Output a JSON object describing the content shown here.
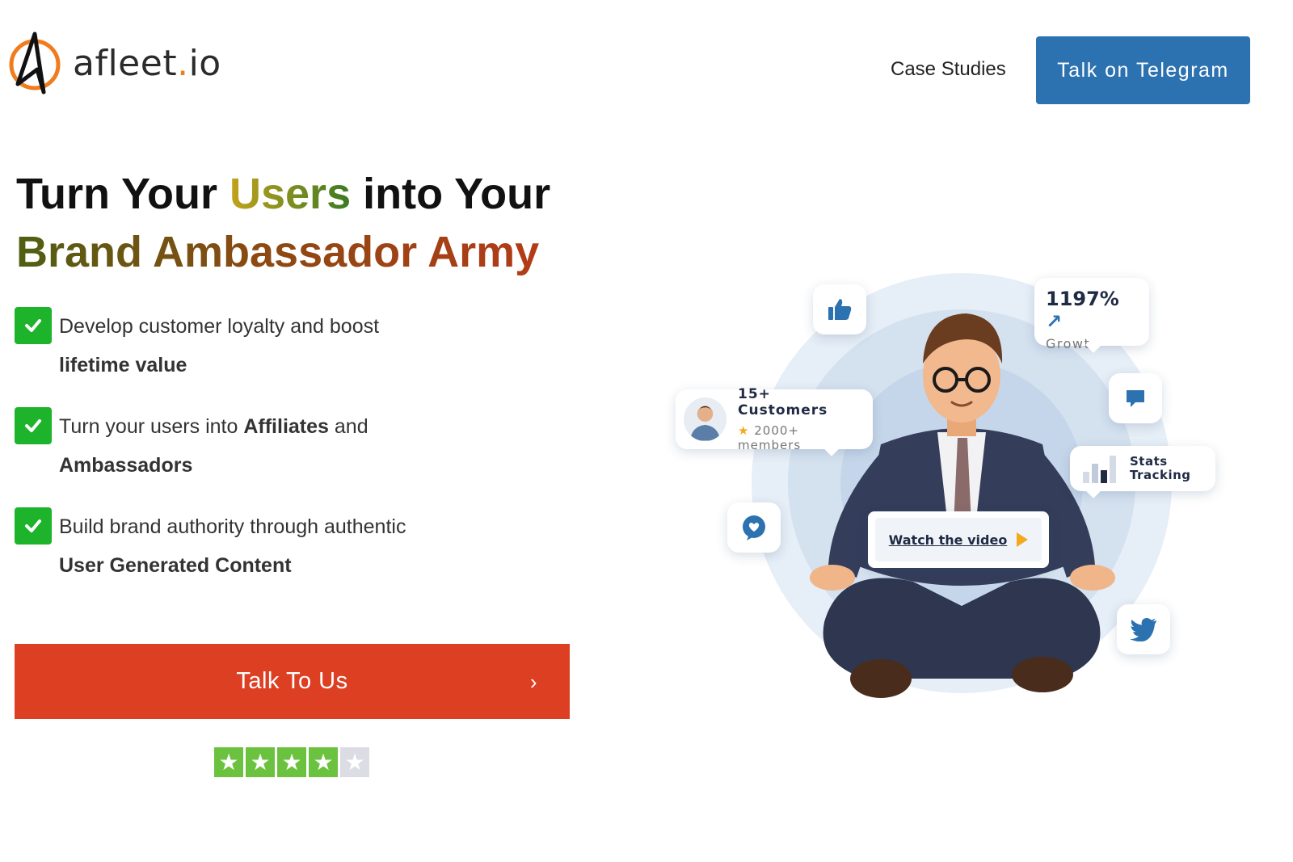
{
  "header": {
    "logo_text": "afleet",
    "logo_dot": ".",
    "logo_suffix": "io",
    "nav_case_studies": "Case Studies",
    "telegram_button": "Talk on Telegram"
  },
  "hero": {
    "headline_part1": "Turn Your ",
    "headline_highlight": "Users",
    "headline_part2": " into Your",
    "headline_line2": "Brand Ambassador Army",
    "features": [
      {
        "text": "Develop customer loyalty and boost ",
        "bold": "lifetime value",
        "after": ""
      },
      {
        "text": "Turn your users into ",
        "bold": "Affiliates",
        "after": " and ",
        "bold2": "Ambassadors"
      },
      {
        "text": "Build brand authority through authentic ",
        "bold": "User Generated Content",
        "after": ""
      }
    ],
    "cta_label": "Talk To Us",
    "cta_chevron": "›",
    "rating": {
      "filled_stars": 4,
      "total_stars": 5
    }
  },
  "illustration": {
    "growth_value": "1197%",
    "growth_arrow": "↗",
    "growth_label": "Growth",
    "customers_title": "15+ Customers",
    "customers_star": "★",
    "customers_sub": "2000+ members",
    "stats_line1": "Stats",
    "stats_line2": "Tracking",
    "watch_video": "Watch the video"
  },
  "colors": {
    "telegram_blue": "#2d72b0",
    "cta_red": "#dd3f23",
    "check_green": "#1db32a",
    "trustpilot_green": "#6bc23f",
    "logo_orange": "#f07c1e"
  }
}
